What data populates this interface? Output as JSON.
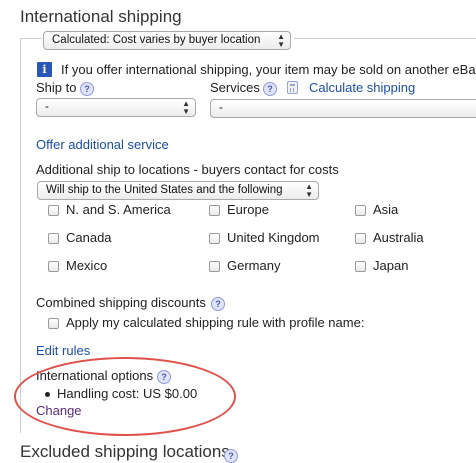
{
  "section_title": "International shipping",
  "shipping_type_select": "Calculated: Cost varies by buyer location",
  "info_message": "If you offer international shipping, your item may be sold on another eBa",
  "ship_to_label": "Ship to",
  "ship_to_select": "-",
  "services_label": "Services",
  "calculate_shipping_link": "Calculate shipping",
  "services_select": "-",
  "offer_additional_service": "Offer additional service",
  "additional_locations_label": "Additional ship to locations - buyers contact for costs",
  "additional_locations_select": "Will ship to the United States and the following",
  "locations": [
    {
      "label": "N. and S. America",
      "checked": false
    },
    {
      "label": "Europe",
      "checked": false
    },
    {
      "label": "Asia",
      "checked": false
    },
    {
      "label": "Canada",
      "checked": false
    },
    {
      "label": "United Kingdom",
      "checked": false
    },
    {
      "label": "Australia",
      "checked": false
    },
    {
      "label": "Mexico",
      "checked": false
    },
    {
      "label": "Germany",
      "checked": false
    },
    {
      "label": "Japan",
      "checked": false
    }
  ],
  "combined_discounts_label": "Combined shipping discounts",
  "apply_rule_label": "Apply my calculated shipping rule with profile name:",
  "edit_rules_link": "Edit rules",
  "international_options_label": "International options",
  "handling_cost": "Handling cost: US $0.00",
  "change_link": "Change",
  "excluded_title": "Excluded shipping locations",
  "colors": {
    "link": "#1b4fa8",
    "visited_link": "#5a2a82",
    "highlight_oval": "#e0504a",
    "info_icon": "#2a58b8"
  }
}
